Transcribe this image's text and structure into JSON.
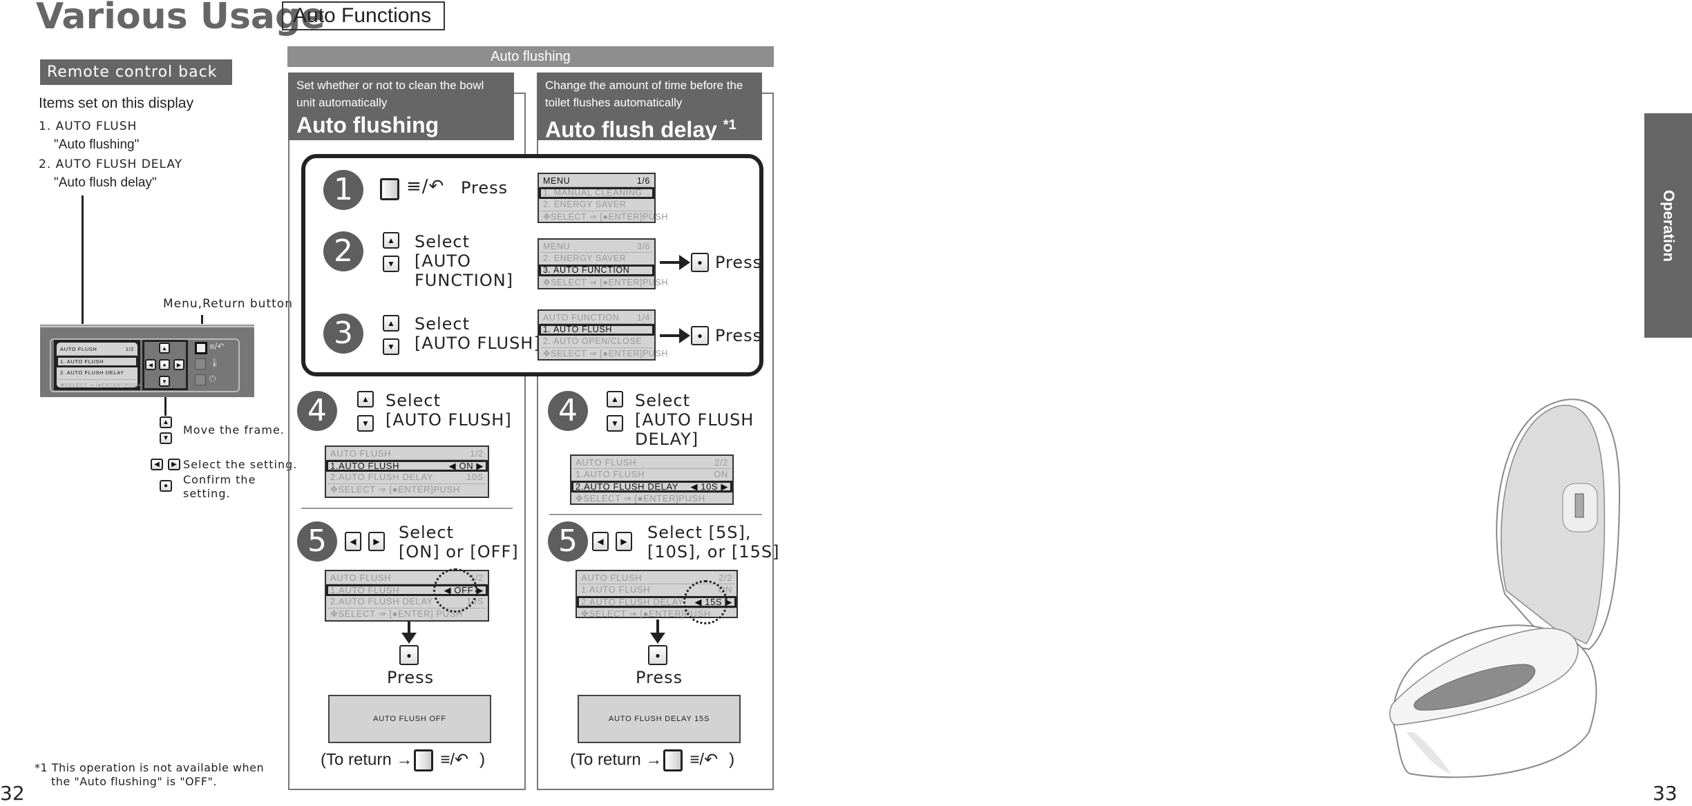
{
  "header": {
    "title": "Various Usage",
    "section": "Auto Functions"
  },
  "left": {
    "label": "Remote control back side",
    "items_heading": "Items set on this display",
    "items": [
      {
        "name": "1. AUTO FLUSH",
        "desc": "\"Auto flushing\""
      },
      {
        "name": "2. AUTO FLUSH DELAY",
        "desc": "\"Auto flush delay\""
      }
    ],
    "menu_return_label": "Menu,Return button",
    "remote_screen": {
      "title": "AUTO FLUSH",
      "page": "1/2",
      "rows": [
        {
          "label": "1. AUTO FLUSH",
          "value": "",
          "framed": true,
          "dark": true
        },
        {
          "label": "2. AUTO FLUSH DELAY",
          "value": "",
          "dark": true
        }
      ],
      "footer": "SELECT ⇒ [●ENTER] PUSH",
      "title_dark": true
    },
    "legend": [
      {
        "icons": [
          "up-arrow",
          "down-arrow"
        ],
        "text": "Move the frame."
      },
      {
        "icons": [
          "left-arrow",
          "right-arrow"
        ],
        "text": "Select the setting."
      },
      {
        "icons": [
          "enter"
        ],
        "text": "Confirm the setting."
      }
    ],
    "footnote_line1": "*1 This operation is not available when",
    "footnote_line2": "the \"Auto flushing\" is \"OFF\".",
    "page_number": "32"
  },
  "bar_title": "Auto flushing",
  "common": {
    "press": "Press",
    "menu_symbol": "≡/↶",
    "step1": {
      "num": "1"
    },
    "step2": {
      "num": "2",
      "text": [
        "Select",
        "[AUTO",
        "FUNCTION]"
      ]
    },
    "step3": {
      "num": "3",
      "text": [
        "Select",
        "[AUTO FLUSH]"
      ]
    },
    "screens": [
      {
        "title": "MENU",
        "page": "1/6",
        "title_dark": true,
        "rows": [
          {
            "label": "1. MANUAL CLEANING",
            "framed": true
          },
          {
            "label": "2. ENERGY SAVER"
          }
        ],
        "footer": "SELECT ⇒ [●ENTER]PUSH"
      },
      {
        "title": "MENU",
        "page": "3/6",
        "rows": [
          {
            "label": "2. ENERGY SAVER"
          },
          {
            "label": "3. AUTO FUNCTION",
            "framed": true,
            "dark": true
          }
        ],
        "footer": "SELECT ⇒ [●ENTER]PUSH"
      },
      {
        "title": "AUTO FUNCTION",
        "page": "1/4",
        "rows": [
          {
            "label": "1. AUTO FLUSH",
            "framed": true,
            "dark": true
          },
          {
            "label": "2. AUTO OPEN/CLOSE"
          }
        ],
        "footer": "SELECT ⇒ [●ENTER]PUSH"
      }
    ]
  },
  "panel_a": {
    "desc": "Set whether or not to clean the bowl unit automatically",
    "heading": "Auto flushing",
    "step4": {
      "num": "4",
      "text": [
        "Select",
        "[AUTO FLUSH]"
      ],
      "screen": {
        "title": "AUTO FLUSH",
        "page": "1/2",
        "rows": [
          {
            "label": "1.AUTO FLUSH",
            "value": "◀ ON ▶",
            "framed": true,
            "dark": true
          },
          {
            "label": "2.AUTO FLUSH DELAY",
            "value": "10S"
          }
        ],
        "footer": "SELECT ⇒ [●ENTER]PUSH"
      }
    },
    "step5": {
      "num": "5",
      "text": [
        "Select",
        "[ON] or [OFF]"
      ],
      "screen": {
        "title": "AUTO FLUSH",
        "page": "1/2",
        "rows": [
          {
            "label": "1.AUTO FLUSH",
            "value": "◀ OFF ▶",
            "framed": true,
            "circled": true,
            "value_dark": true
          },
          {
            "label": "2.AUTO FLUSH DELAY",
            "value": "10S"
          }
        ],
        "footer": "SELECT ⇒ [●ENTER] PUSH"
      }
    },
    "result": "AUTO FLUSH OFF",
    "return_prefix": "(To return →",
    "return_suffix": ")"
  },
  "panel_b": {
    "desc": "Change the amount of time before the toilet flushes automatically",
    "heading": "Auto flush delay",
    "footnote_mark": "*1",
    "step4": {
      "num": "4",
      "text": [
        "Select",
        "[AUTO FLUSH",
        "DELAY]"
      ],
      "screen": {
        "title": "AUTO FLUSH",
        "page": "2/2",
        "rows": [
          {
            "label": "1.AUTO FLUSH",
            "value": "ON"
          },
          {
            "label": "2.AUTO FLUSH DELAY",
            "value": "◀ 10S ▶",
            "framed": true,
            "dark": true
          }
        ],
        "footer": "SELECT ⇒ [●ENTER]PUSH"
      }
    },
    "step5": {
      "num": "5",
      "text": [
        "Select [5S],",
        "[10S], or [15S]"
      ],
      "screen": {
        "title": "AUTO FLUSH",
        "page": "2/2",
        "rows": [
          {
            "label": "1.AUTO FLUSH",
            "value": "ON"
          },
          {
            "label": "2.AUTO FLUSH DELAY",
            "value": "◀ 15S ▶",
            "framed": true,
            "circled": true,
            "value_dark": true
          }
        ],
        "footer": "SELECT ⇒ [●ENTER]PUSH"
      }
    },
    "result": "AUTO FLUSH DELAY 15S",
    "return_prefix": "(To return →",
    "return_suffix": ")"
  },
  "side_tab": "Operation",
  "right_page_number": "33",
  "colors": {
    "dark_label": "#666666",
    "bar": "#8e8e8e",
    "lcd": "#d3d3d3"
  }
}
